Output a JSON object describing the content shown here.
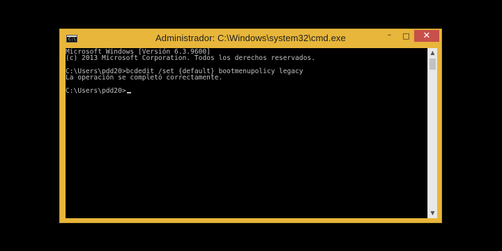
{
  "window": {
    "title": "Administrador: C:\\Windows\\system32\\cmd.exe",
    "icon": "cmd-icon",
    "icon_glyph": "C:\\",
    "frame_color": "#e8b63a",
    "close_color": "#c7504b",
    "controls": {
      "minimize": "–",
      "maximize": "□",
      "close": "✕"
    }
  },
  "console": {
    "lines": [
      "Microsoft Windows [Versión 6.3.9600]",
      "(c) 2013 Microsoft Corporation. Todos los derechos reservados.",
      "",
      "C:\\Users\\pdd20>bcdedit /set {default} bootmenupolicy legacy",
      "La operación se completó correctamente.",
      "",
      "C:\\Users\\pdd20>"
    ]
  },
  "scrollbar": {
    "up_arrow": "▲",
    "down_arrow": "▼"
  }
}
